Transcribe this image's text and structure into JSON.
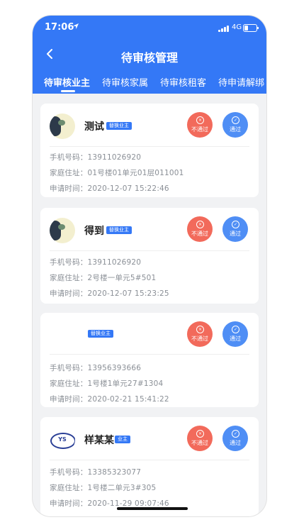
{
  "status_bar": {
    "time": "17:06",
    "network": "4G"
  },
  "header": {
    "title": "待审核管理"
  },
  "tabs": [
    {
      "label": "待审核业主"
    },
    {
      "label": "待审核家属"
    },
    {
      "label": "待审核租客"
    },
    {
      "label": "待申请解绑"
    }
  ],
  "labels": {
    "phone": "手机号码：",
    "address": "家庭住址：",
    "time": "申请时间：",
    "reject": "不通过",
    "pass": "通过"
  },
  "cards": [
    {
      "name": "测试",
      "badge": "替换业主",
      "phone": "13911026920",
      "address": "01号楼01单元01层011001",
      "time": "2020-12-07 15:22:46"
    },
    {
      "name": "得到",
      "badge": "替换业主",
      "phone": "13911026920",
      "address": "2号楼一单元5#501",
      "time": "2020-12-07 15:23:25"
    },
    {
      "name": "",
      "badge": "替换业主",
      "phone": "13956393666",
      "address": "1号楼1单元27#1304",
      "time": "2020-02-21 15:41:22"
    },
    {
      "name": "样某某",
      "badge": "业主",
      "phone": "13385323077",
      "address": "1号楼二单元3#305",
      "time": "2020-11-29 09:07:46",
      "avatar_text": "YS"
    }
  ]
}
